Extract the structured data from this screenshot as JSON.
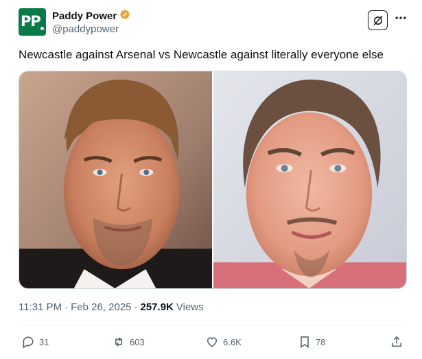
{
  "author": {
    "display_name": "Paddy Power",
    "handle": "@paddypower",
    "avatar_text": "PP",
    "verified_icon": "verified-badge-icon",
    "brand_color": "#0a7a46",
    "verified_color": "#e8a33d"
  },
  "tweet": {
    "text": "Newcastle against Arsenal vs Newcastle against literally everyone else"
  },
  "media": {
    "count": 2
  },
  "meta": {
    "time": "11:31 PM",
    "separator": "·",
    "date": "Feb 26, 2025",
    "views_count": "257.9K",
    "views_label": "Views"
  },
  "actions": {
    "replies": "31",
    "reposts": "603",
    "likes": "6.6K",
    "bookmarks": "78"
  },
  "colors": {
    "text": "#0f1419",
    "muted": "#536471",
    "border": "#cfd9de"
  }
}
